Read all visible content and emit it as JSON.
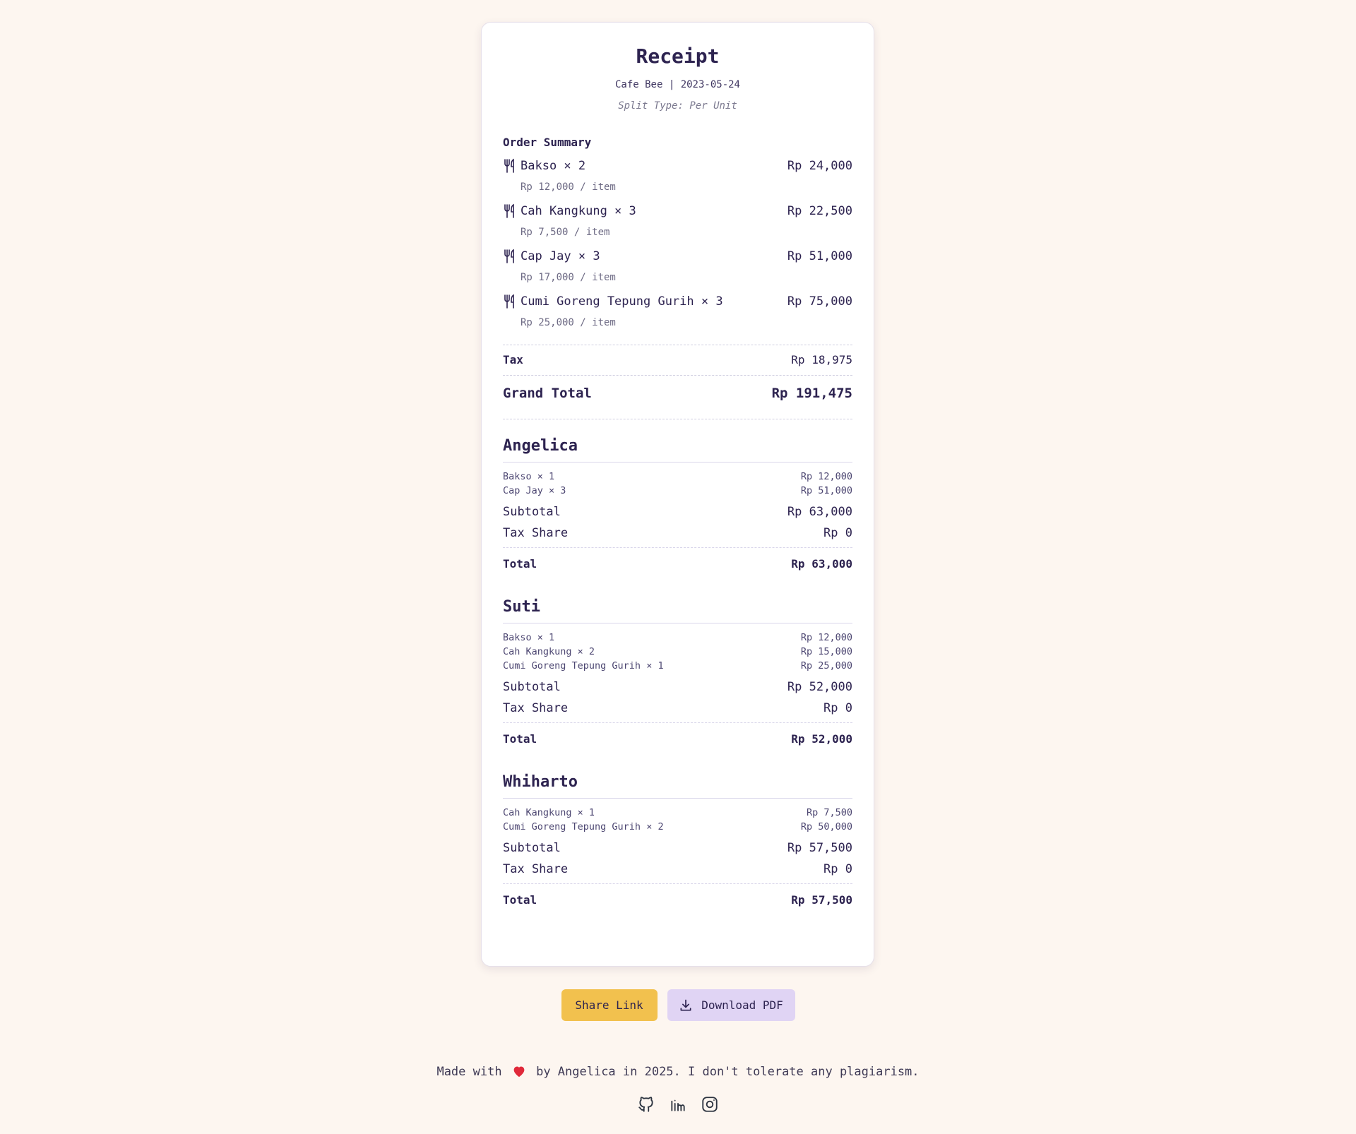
{
  "receipt": {
    "title": "Receipt",
    "meta": "Cafe Bee | 2023-05-24",
    "split_type": "Split Type: Per Unit",
    "order_summary_label": "Order Summary",
    "items": [
      {
        "name": "Bakso × 2",
        "total": "Rp 24,000",
        "unit": "Rp 12,000 / item",
        "icon": "fork-knife-icon"
      },
      {
        "name": "Cah Kangkung × 3",
        "total": "Rp 22,500",
        "unit": "Rp 7,500 / item",
        "icon": "fork-knife-icon"
      },
      {
        "name": "Cap Jay × 3",
        "total": "Rp 51,000",
        "unit": "Rp 17,000 / item",
        "icon": "fork-knife-icon"
      },
      {
        "name": "Cumi Goreng Tepung Gurih × 3",
        "total": "Rp 75,000",
        "unit": "Rp 25,000 / item",
        "icon": "fork-knife-icon"
      }
    ],
    "tax_label": "Tax",
    "tax_value": "Rp 18,975",
    "grand_total_label": "Grand Total",
    "grand_total_value": "Rp 191,475"
  },
  "people": [
    {
      "name": "Angelica",
      "items": [
        {
          "name": "Bakso × 1",
          "amount": "Rp 12,000"
        },
        {
          "name": "Cap Jay × 3",
          "amount": "Rp 51,000"
        }
      ],
      "subtotal_label": "Subtotal",
      "subtotal": "Rp 63,000",
      "tax_label": "Tax Share",
      "tax": "Rp 0",
      "total_label": "Total",
      "total": "Rp 63,000"
    },
    {
      "name": "Suti",
      "items": [
        {
          "name": "Bakso × 1",
          "amount": "Rp 12,000"
        },
        {
          "name": "Cah Kangkung × 2",
          "amount": "Rp 15,000"
        },
        {
          "name": "Cumi Goreng Tepung Gurih × 1",
          "amount": "Rp 25,000"
        }
      ],
      "subtotal_label": "Subtotal",
      "subtotal": "Rp 52,000",
      "tax_label": "Tax Share",
      "tax": "Rp 0",
      "total_label": "Total",
      "total": "Rp 52,000"
    },
    {
      "name": "Whiharto",
      "items": [
        {
          "name": "Cah Kangkung × 1",
          "amount": "Rp 7,500"
        },
        {
          "name": "Cumi Goreng Tepung Gurih × 2",
          "amount": "Rp 50,000"
        }
      ],
      "subtotal_label": "Subtotal",
      "subtotal": "Rp 57,500",
      "tax_label": "Tax Share",
      "tax": "Rp 0",
      "total_label": "Total",
      "total": "Rp 57,500"
    }
  ],
  "actions": {
    "share_label": "Share Link",
    "download_label": "Download PDF",
    "download_icon": "download-icon"
  },
  "footer": {
    "text_before": "Made with",
    "text_after": "by Angelica in 2025. I don't tolerate any plagiarism.",
    "heart_icon": "heart-icon",
    "heart_color": "#e0293a",
    "socials": [
      "github-icon",
      "linkedin-icon",
      "instagram-icon"
    ]
  },
  "colors": {
    "background": "#fdf6f0",
    "card": "#ffffff",
    "text": "#2d2350",
    "share_button": "#f2c14e",
    "download_button": "#e0d4f4"
  }
}
